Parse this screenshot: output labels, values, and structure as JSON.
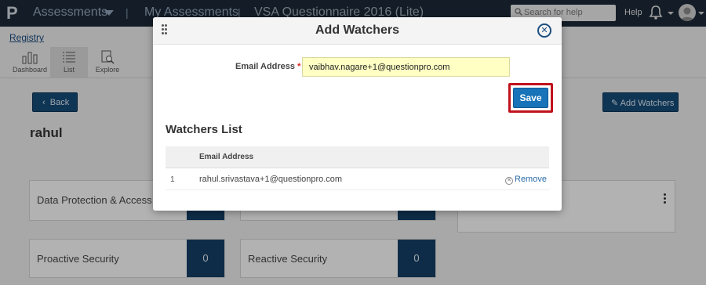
{
  "topbar": {
    "logo": "P",
    "app_label": "Assessments",
    "my_assessments": "My Assessments",
    "survey_title": "VSA Questionnaire 2016 (Lite)",
    "search_placeholder": "Search for help",
    "help_label": "Help"
  },
  "breadcrumb": {
    "registry": "Registry"
  },
  "toolbar": {
    "items": [
      {
        "label": "Dashboard",
        "icon": "bar-chart-icon"
      },
      {
        "label": "List",
        "icon": "list-icon"
      },
      {
        "label": "Explore",
        "icon": "explore-icon"
      }
    ]
  },
  "page": {
    "back_label": "Back",
    "add_watchers_label": "Add Watchers",
    "person_name": "rahul"
  },
  "cards": [
    {
      "label": "Data Protection & Access",
      "count": ""
    },
    {
      "label": "",
      "count": ""
    },
    {
      "label": "Proactive Security",
      "count": "0"
    },
    {
      "label": "Reactive Security",
      "count": "0"
    }
  ],
  "modal": {
    "title": "Add Watchers",
    "email_label": "Email Address",
    "required_mark": "*",
    "email_value": "vaibhav.nagare+1@questionpro.com",
    "save_label": "Save",
    "watchers_title": "Watchers List",
    "column_email": "Email Address",
    "watchers": [
      {
        "index": "1",
        "email": "rahul.srivastava+1@questionpro.com",
        "action": "Remove"
      }
    ]
  },
  "colors": {
    "topbar_bg": "#1d2937",
    "primary_button": "#1873b8",
    "highlight_border": "#c0121d",
    "card_count_bg": "#143d63",
    "input_highlight": "#ffffc4"
  }
}
